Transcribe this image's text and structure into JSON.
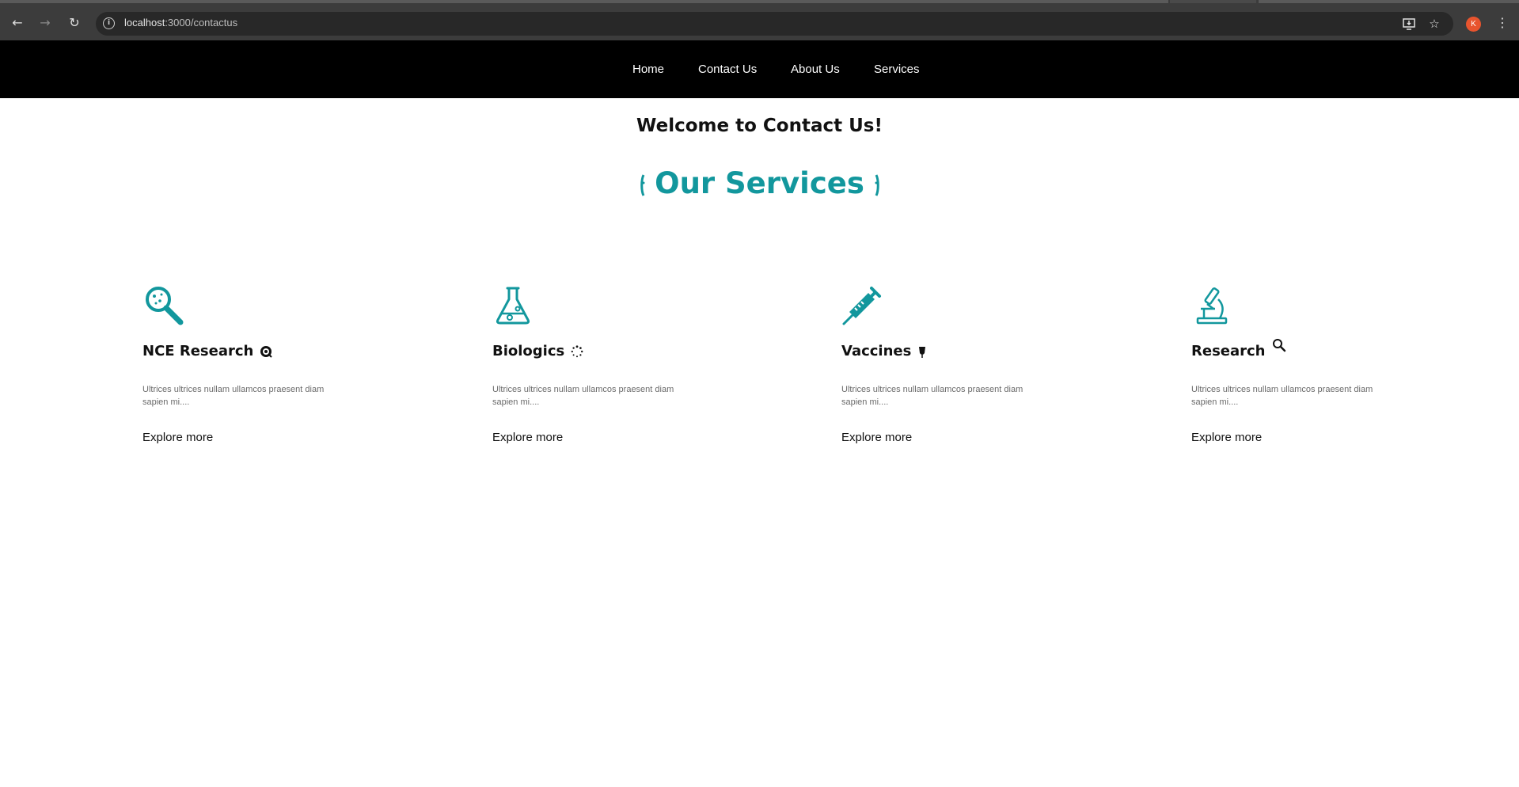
{
  "browser": {
    "url_host": "localhost",
    "url_path": ":3000/contactus",
    "avatar_letter": "K",
    "icons": [
      "back-arrow-icon",
      "forward-arrow-icon",
      "reload-icon",
      "site-info-icon",
      "install-app-icon",
      "bookmark-star-icon",
      "more-menu-icon"
    ]
  },
  "nav": {
    "items": [
      {
        "label": "Home"
      },
      {
        "label": "Contact Us"
      },
      {
        "label": "About Us"
      },
      {
        "label": "Services"
      }
    ]
  },
  "page": {
    "welcome": "Welcome to Contact Us!",
    "services_title": "Our Services",
    "accent_color": "#12979d"
  },
  "cards": [
    {
      "title": "NCE Research",
      "icon": "magnifier-icon",
      "title_icon": "target-icon",
      "desc": "Ultrices ultrices nullam ullamcos praesent diam sapien mi....",
      "link": "Explore more"
    },
    {
      "title": "Biologics",
      "icon": "flask-icon",
      "title_icon": "spinner-icon",
      "desc": "Ultrices ultrices nullam ullamcos praesent diam sapien mi....",
      "link": "Explore more"
    },
    {
      "title": "Vaccines",
      "icon": "syringe-icon",
      "title_icon": "pin-icon",
      "desc": "Ultrices ultrices nullam ullamcos praesent diam sapien mi....",
      "link": "Explore more"
    },
    {
      "title": "Research",
      "icon": "microscope-icon",
      "title_icon": "search-icon",
      "desc": "Ultrices ultrices nullam ullamcos praesent diam sapien mi....",
      "link": "Explore more"
    }
  ]
}
